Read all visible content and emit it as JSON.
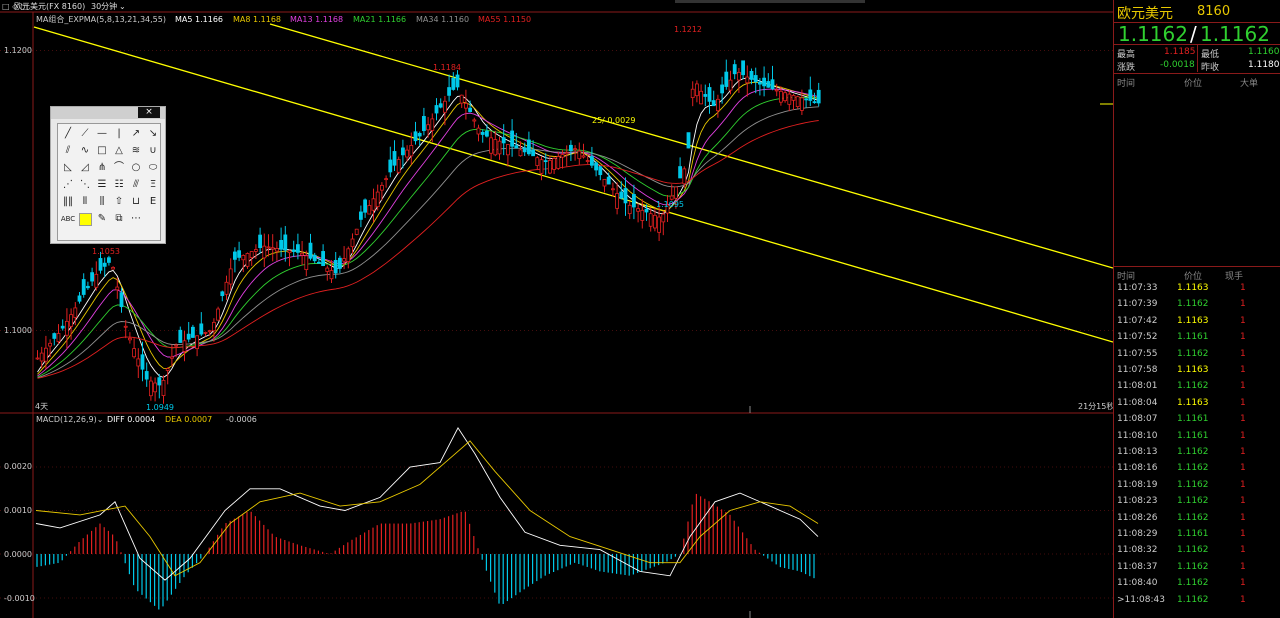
{
  "header": {
    "tabs_glyph": "□ ◇ □",
    "symbol": "欧元美元(FX 8160)",
    "period": "30分钟",
    "period_caret": "⌄",
    "indicator_label": "MA组合_EXPMA(5,8,13,21,34,55)",
    "ma_values": [
      {
        "label": "MA5",
        "value": "1.1166",
        "color": "#ffffff"
      },
      {
        "label": "MA8",
        "value": "1.1168",
        "color": "#e8c800"
      },
      {
        "label": "MA13",
        "value": "1.1168",
        "color": "#e040e0"
      },
      {
        "label": "MA21",
        "value": "1.1166",
        "color": "#30d030"
      },
      {
        "label": "MA34",
        "value": "1.1160",
        "color": "#909090"
      },
      {
        "label": "MA55",
        "value": "1.1150",
        "color": "#e02020"
      }
    ]
  },
  "price_axis": {
    "ticks": [
      "1.1200",
      "1.1000"
    ]
  },
  "price_annotations": {
    "high_main": "1.1212",
    "high_left": "1.1184",
    "left_peak": "1.1053",
    "low": "1.0949",
    "trough": "1.1095",
    "fib_label": "25/ 0.0029",
    "days_label": "4天",
    "time_remaining": "21分15秒"
  },
  "macd": {
    "label": "MACD(12,26,9)⌄",
    "diff_label": "DIFF 0.0004",
    "dea_label": "DEA 0.0007",
    "macd_value": "-0.0006",
    "ticks": [
      "0.0020",
      "0.0010",
      "0.0000",
      "-0.0010"
    ]
  },
  "colors": {
    "up": "#e02020",
    "down": "#00c8e8",
    "channel": "#ffff00",
    "axis": "#8a1a1a",
    "green": "#30d030",
    "red": "#e02020",
    "price_yellow": "#ffff00"
  },
  "quote": {
    "name": "欧元美元",
    "code": "8160",
    "bid": "1.1162",
    "slash": "/",
    "ask": "1.1162",
    "high_label": "最高",
    "high": "1.1185",
    "low_label": "最低",
    "low": "1.1160",
    "change_label": "涨跌",
    "change": "-0.0018",
    "prev_close_label": "昨收",
    "prev_close": "1.1180"
  },
  "big_orders": {
    "headers": [
      "时间",
      "价位",
      "大单"
    ]
  },
  "ticks": {
    "headers": [
      "时间",
      "价位",
      "现手"
    ],
    "rows": [
      {
        "time": "11:07:33",
        "price": "1.1163",
        "vol": "1",
        "price_color": "#ffff00"
      },
      {
        "time": "11:07:39",
        "price": "1.1162",
        "vol": "1",
        "price_color": "#30d030"
      },
      {
        "time": "11:07:42",
        "price": "1.1163",
        "vol": "1",
        "price_color": "#ffff00"
      },
      {
        "time": "11:07:52",
        "price": "1.1161",
        "vol": "1",
        "price_color": "#30d030"
      },
      {
        "time": "11:07:55",
        "price": "1.1162",
        "vol": "1",
        "price_color": "#30d030"
      },
      {
        "time": "11:07:58",
        "price": "1.1163",
        "vol": "1",
        "price_color": "#ffff00"
      },
      {
        "time": "11:08:01",
        "price": "1.1162",
        "vol": "1",
        "price_color": "#30d030"
      },
      {
        "time": "11:08:04",
        "price": "1.1163",
        "vol": "1",
        "price_color": "#ffff00"
      },
      {
        "time": "11:08:07",
        "price": "1.1161",
        "vol": "1",
        "price_color": "#30d030"
      },
      {
        "time": "11:08:10",
        "price": "1.1161",
        "vol": "1",
        "price_color": "#30d030"
      },
      {
        "time": "11:08:13",
        "price": "1.1162",
        "vol": "1",
        "price_color": "#30d030"
      },
      {
        "time": "11:08:16",
        "price": "1.1162",
        "vol": "1",
        "price_color": "#30d030"
      },
      {
        "time": "11:08:19",
        "price": "1.1162",
        "vol": "1",
        "price_color": "#30d030"
      },
      {
        "time": "11:08:23",
        "price": "1.1162",
        "vol": "1",
        "price_color": "#30d030"
      },
      {
        "time": "11:08:26",
        "price": "1.1162",
        "vol": "1",
        "price_color": "#30d030"
      },
      {
        "time": "11:08:29",
        "price": "1.1161",
        "vol": "1",
        "price_color": "#30d030"
      },
      {
        "time": "11:08:32",
        "price": "1.1162",
        "vol": "1",
        "price_color": "#30d030"
      },
      {
        "time": "11:08:37",
        "price": "1.1162",
        "vol": "1",
        "price_color": "#30d030"
      },
      {
        "time": "11:08:40",
        "price": "1.1162",
        "vol": "1",
        "price_color": "#30d030"
      },
      {
        "time": ">11:08:43",
        "price": "1.1162",
        "vol": "1",
        "price_color": "#30d030"
      }
    ]
  },
  "toolbox": {
    "close_glyph": "×",
    "tools": [
      [
        "line-tool",
        "╱"
      ],
      [
        "ray-tool",
        "⟋"
      ],
      [
        "hline-tool",
        "—"
      ],
      [
        "vline-tool",
        "|"
      ],
      [
        "arrow-tool",
        "↗"
      ],
      [
        "arrow-down-tool",
        "↘"
      ],
      [
        "parallel-tool",
        "⫽"
      ],
      [
        "wave-tool",
        "∿"
      ],
      [
        "rect-tool",
        "□"
      ],
      [
        "triangle-tool",
        "△"
      ],
      [
        "zigzag-tool",
        "≋"
      ],
      [
        "cup-tool",
        "∪"
      ],
      [
        "gann-tool",
        "◺"
      ],
      [
        "angle-tool",
        "◿"
      ],
      [
        "pitchfork-tool",
        "⋔"
      ],
      [
        "arc-tool",
        "⌒"
      ],
      [
        "circle-tool",
        "○"
      ],
      [
        "ellipse-tool",
        "⬭"
      ],
      [
        "fan-tool",
        "⋰"
      ],
      [
        "fan2-tool",
        "⋱"
      ],
      [
        "fib-tool",
        "☰"
      ],
      [
        "fib2-tool",
        "☷"
      ],
      [
        "speed-tool",
        "⫻"
      ],
      [
        "fibext-tool",
        "Ξ"
      ],
      [
        "cycle-tool",
        "‖‖"
      ],
      [
        "cycle2-tool",
        "⦀"
      ],
      [
        "period-tool",
        "⫼"
      ],
      [
        "up-arrow-tool",
        "⇧"
      ],
      [
        "ruler-tool",
        "⊔"
      ],
      [
        "bracket-tool",
        "E"
      ],
      [
        "text-tool",
        "ABC"
      ],
      [
        "color-tool",
        ""
      ],
      [
        "eraser-tool",
        "✎"
      ],
      [
        "delete-tool",
        "⧉"
      ],
      [
        "more-tool",
        "⋯"
      ]
    ],
    "text_tool_label": "ABC"
  }
}
